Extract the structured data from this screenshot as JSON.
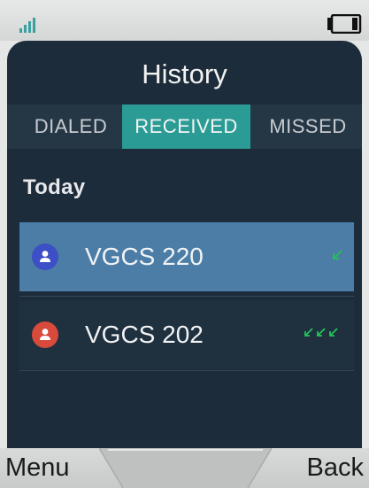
{
  "status": {
    "signal_icon": "signal-bars-icon",
    "battery_icon": "battery-icon"
  },
  "screen": {
    "title": "History",
    "tabs": [
      {
        "label": "DIALED",
        "selected": false
      },
      {
        "label": "RECEIVED",
        "selected": true
      },
      {
        "label": "MISSED",
        "selected": false
      }
    ],
    "section": "Today",
    "entries": [
      {
        "name": "VGCS 220",
        "avatar_color": "#3d4fc4",
        "call_icon": "received-call-arrow-icon",
        "arrow_count": 1,
        "highlighted": true
      },
      {
        "name": "VGCS 202",
        "avatar_color": "#d84a3b",
        "call_icon": "received-call-arrow-icon",
        "arrow_count": 3,
        "highlighted": false
      }
    ]
  },
  "softkeys": {
    "left": "Menu",
    "right": "Back"
  },
  "colors": {
    "accent": "#2b9c95",
    "highlight_row": "#4b7da7",
    "screen_bg": "#1d2c3a",
    "call_arrow": "#24c25a"
  }
}
